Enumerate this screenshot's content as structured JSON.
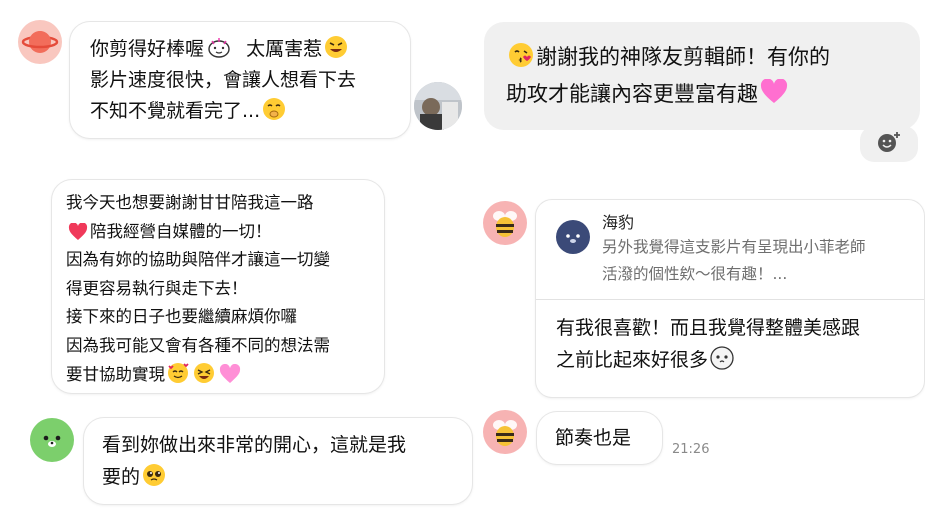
{
  "messages": {
    "m1": {
      "lines": [
        "你剪得好棒喔",
        "太厲害惹",
        "影片速度很快，會讓人想看下去",
        "不知不覺就看完了..."
      ]
    },
    "m2": {
      "lines": [
        "謝謝我的神隊友剪輯師！有你的",
        "助攻才能讓內容更豐富有趣"
      ]
    },
    "m3": {
      "lines": [
        "我今天也想要謝謝甘甘陪我這一路",
        "陪我經營自媒體的一切！",
        "因為有妳的協助與陪伴才讓這一切變",
        "得更容易執行與走下去！",
        "接下來的日子也要繼續麻煩你囉",
        "因為我可能又會有各種不同的想法需",
        "要甘協助實現"
      ]
    },
    "m4": {
      "quote_name": "海豹",
      "quote_lines": [
        "另外我覺得這支影片有呈現出小菲老師",
        "活潑的個性欸～很有趣！..."
      ],
      "lines": [
        "有我很喜歡！而且我覺得整體美感跟",
        "之前比起來好很多"
      ]
    },
    "m5": {
      "lines": [
        "節奏也是"
      ],
      "time": "21:26"
    },
    "m6": {
      "lines": [
        "看到妳做出來非常的開心，這就是我",
        "要的"
      ]
    }
  },
  "icons": {
    "planet_avatar": "planet-avatar",
    "bee_avatar": "bee-avatar",
    "bear_avatar": "bear-avatar",
    "seal_avatar": "seal-avatar",
    "photo_avatar": "photo-avatar",
    "add_reaction": "add-reaction-icon"
  },
  "colors": {
    "bubble_left": "#ffffff",
    "bubble_right": "#f0f0f0",
    "avatar_pink": "#f7b3b3",
    "avatar_green": "#7ccf6c",
    "avatar_navy": "#3b4a78",
    "planet_pink": "#f4a7a0",
    "timestamp": "#8a8a8a"
  }
}
